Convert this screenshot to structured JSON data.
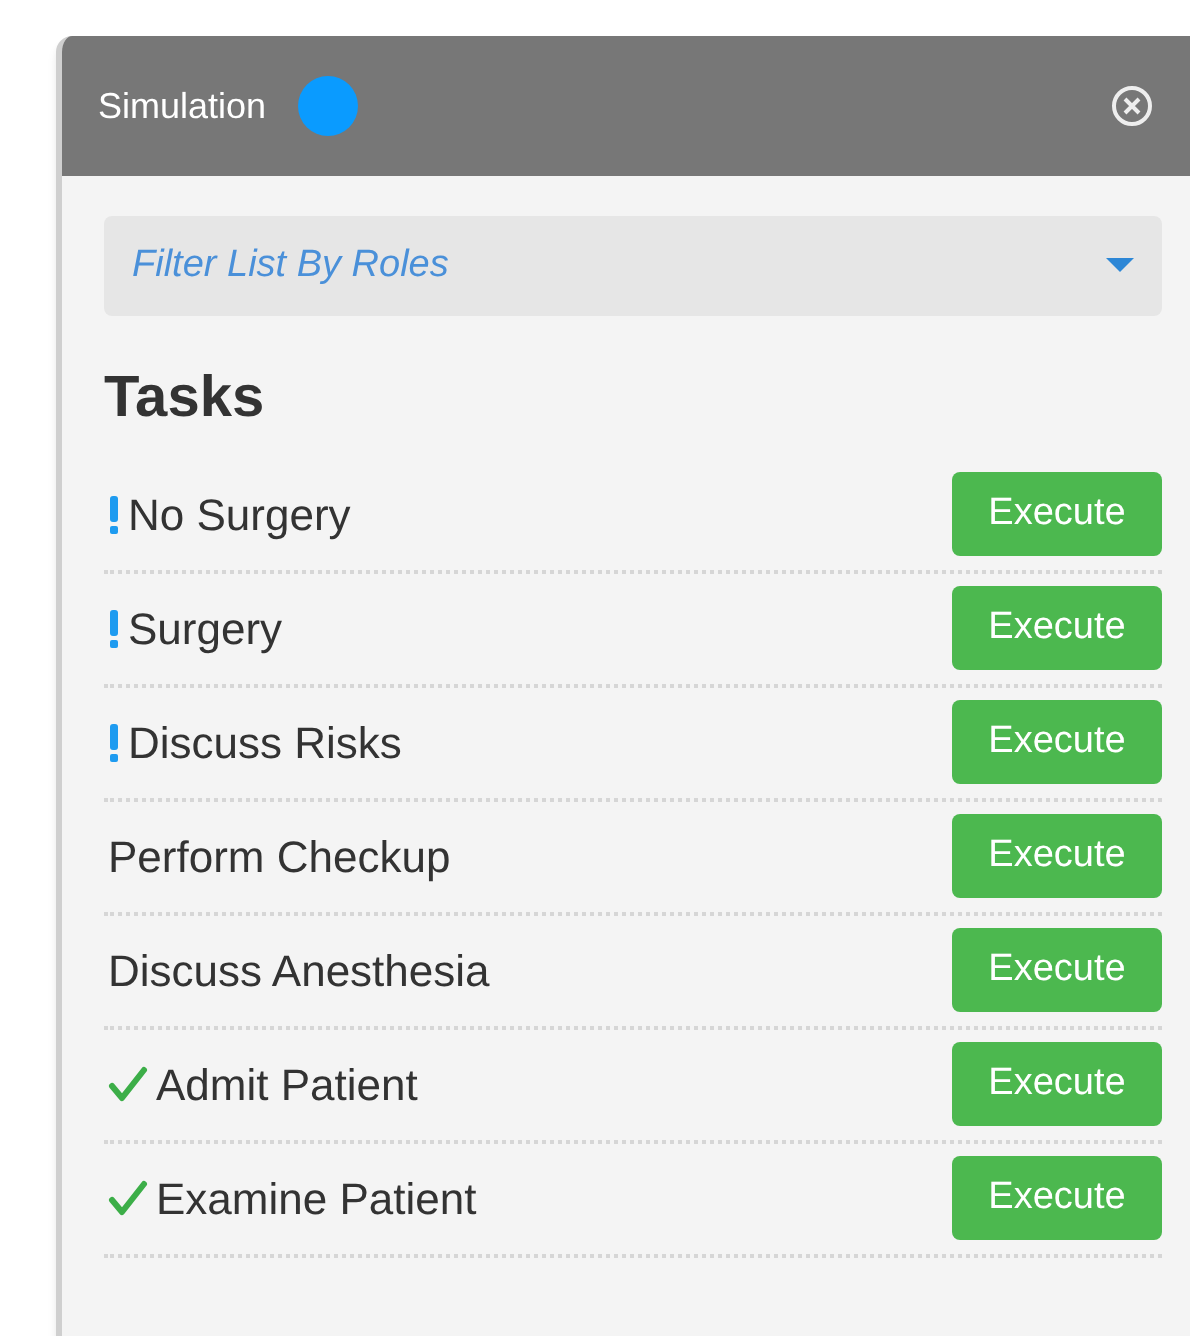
{
  "panel": {
    "title": "Simulation",
    "color": "#0a9bff"
  },
  "filter": {
    "placeholder": "Filter List By Roles"
  },
  "section_title": "Tasks",
  "tasks": [
    {
      "label": "No Surgery",
      "kind": "pending",
      "action": "Execute"
    },
    {
      "label": "Surgery",
      "kind": "pending",
      "action": "Execute"
    },
    {
      "label": "Discuss Risks",
      "kind": "pending",
      "action": "Execute"
    },
    {
      "label": "Perform Checkup",
      "kind": "plain",
      "action": "Execute"
    },
    {
      "label": "Discuss Anesthesia",
      "kind": "plain",
      "action": "Execute"
    },
    {
      "label": "Admit Patient",
      "kind": "done",
      "action": "Execute"
    },
    {
      "label": "Examine Patient",
      "kind": "done",
      "action": "Execute"
    }
  ]
}
